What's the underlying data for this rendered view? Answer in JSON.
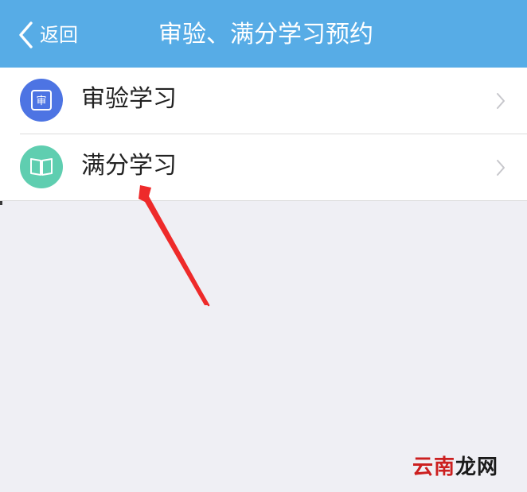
{
  "header": {
    "back_label": "返回",
    "title": "审验、满分学习预约",
    "background_color": "#57ace6"
  },
  "list": {
    "items": [
      {
        "label": "审验学习",
        "icon": "audit-seal-icon",
        "icon_glyph": "审",
        "icon_color": "#4d74e3"
      },
      {
        "label": "满分学习",
        "icon": "open-book-icon",
        "icon_color": "#5fceb0"
      }
    ]
  },
  "annotation": {
    "type": "red-arrow",
    "color": "#ee2a2a",
    "points_to": "满分学习"
  },
  "watermark": {
    "part1": "云南",
    "part2": "龙网"
  }
}
